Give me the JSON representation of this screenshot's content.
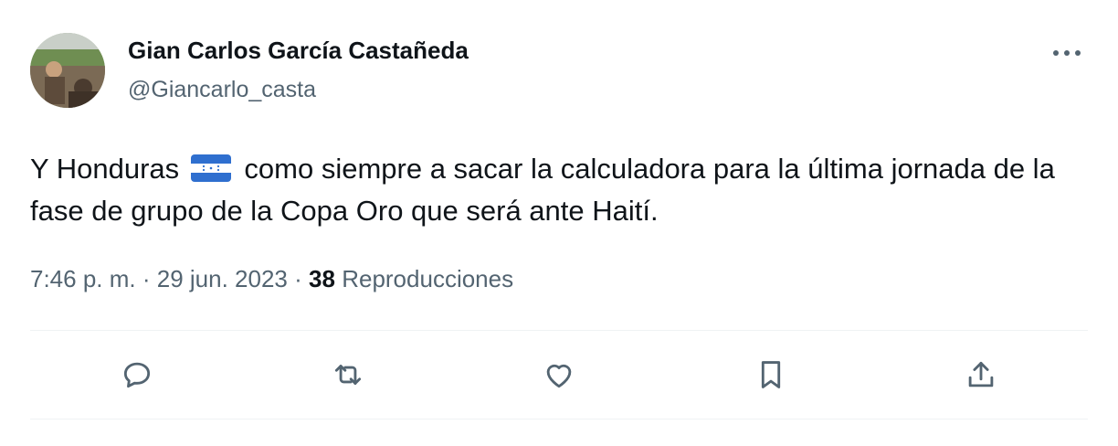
{
  "author": {
    "display_name": "Gian Carlos García Castañeda",
    "handle": "@Giancarlo_casta"
  },
  "tweet": {
    "text_before_flag": "Y Honduras",
    "flag": "honduras-flag-icon",
    "text_after_flag": "como siempre a sacar la calculadora para la última jornada de la fase de grupo de la Copa Oro que será ante Haití."
  },
  "meta": {
    "time": "7:46 p. m.",
    "separator": "·",
    "date": "29 jun. 2023",
    "views_count": "38",
    "views_label": "Reproducciones"
  },
  "actions": [
    {
      "name": "reply",
      "icon": "speech-bubble-icon"
    },
    {
      "name": "retweet",
      "icon": "retweet-arrows-icon"
    },
    {
      "name": "like",
      "icon": "heart-icon"
    },
    {
      "name": "bookmark",
      "icon": "bookmark-icon"
    },
    {
      "name": "share",
      "icon": "share-upload-icon"
    }
  ],
  "colors": {
    "text_primary": "#0f1419",
    "text_secondary": "#536471",
    "divider": "#eff3f4",
    "flag_blue": "#2f6fcf"
  }
}
